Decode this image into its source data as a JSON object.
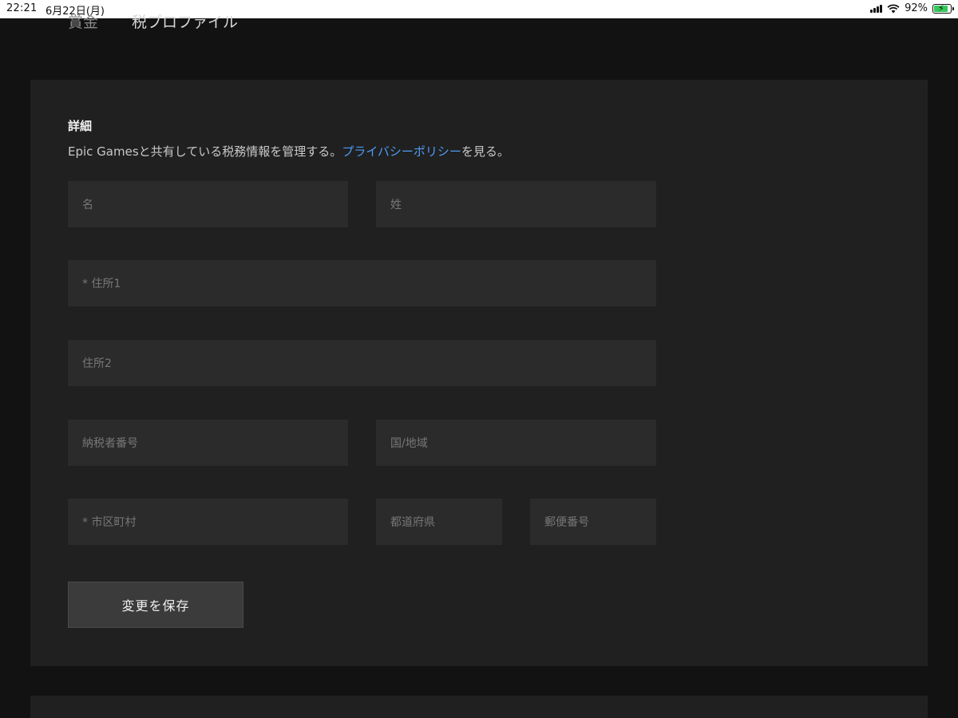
{
  "status_bar": {
    "time": "22:21",
    "date": "6月22日(月)",
    "battery_percent": "92%",
    "battery_level": 0.92,
    "charging": true,
    "colors": {
      "battery_fill": "#35c759"
    }
  },
  "top_tabs": {
    "tab1": "賞金",
    "tab2": "税プロファイル"
  },
  "details": {
    "title": "詳細",
    "description": "Epic Gamesと共有している税務情報を管理する。",
    "privacy_link": "プライバシーポリシー",
    "description_suffix": "を見る。"
  },
  "form": {
    "first_name_placeholder": "名",
    "last_name_placeholder": "姓",
    "address1_placeholder": "* 住所1",
    "address2_placeholder": "住所2",
    "taxpayer_number_placeholder": "納税者番号",
    "country_placeholder": "国/地域",
    "city_placeholder": "* 市区町村",
    "prefecture_placeholder": "都道府県",
    "postal_code_placeholder": "郵便番号",
    "save_label": "変更を保存"
  },
  "colors": {
    "background": "#121212",
    "card": "#202020",
    "field": "#2b2b2b",
    "link": "#4f9cf5",
    "button": "#3b3b3b"
  }
}
